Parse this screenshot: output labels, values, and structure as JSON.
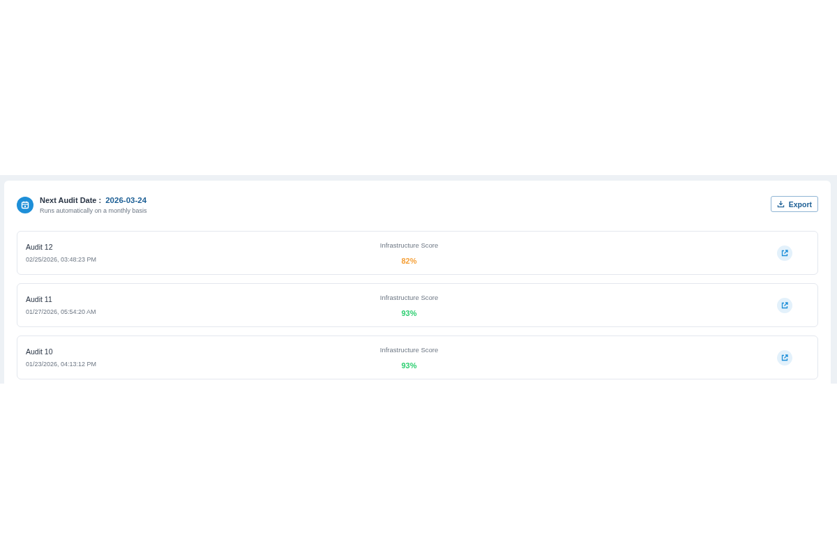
{
  "header": {
    "label": "Next Audit Date :",
    "date": "2026-03-24",
    "subtitle": "Runs automatically on a monthly basis"
  },
  "export_button": {
    "label": "Export"
  },
  "audits": [
    {
      "title": "Audit 12",
      "timestamp": "02/25/2026, 03:48:23 PM",
      "score_label": "Infrastructure Score",
      "score": "82%",
      "color": "#f5a13a"
    },
    {
      "title": "Audit 11",
      "timestamp": "01/27/2026, 05:54:20 AM",
      "score_label": "Infrastructure Score",
      "score": "93%",
      "color": "#2fcf72"
    },
    {
      "title": "Audit 10",
      "timestamp": "01/23/2026, 04:13:12 PM",
      "score_label": "Infrastructure Score",
      "score": "93%",
      "color": "#2fcf72"
    }
  ]
}
